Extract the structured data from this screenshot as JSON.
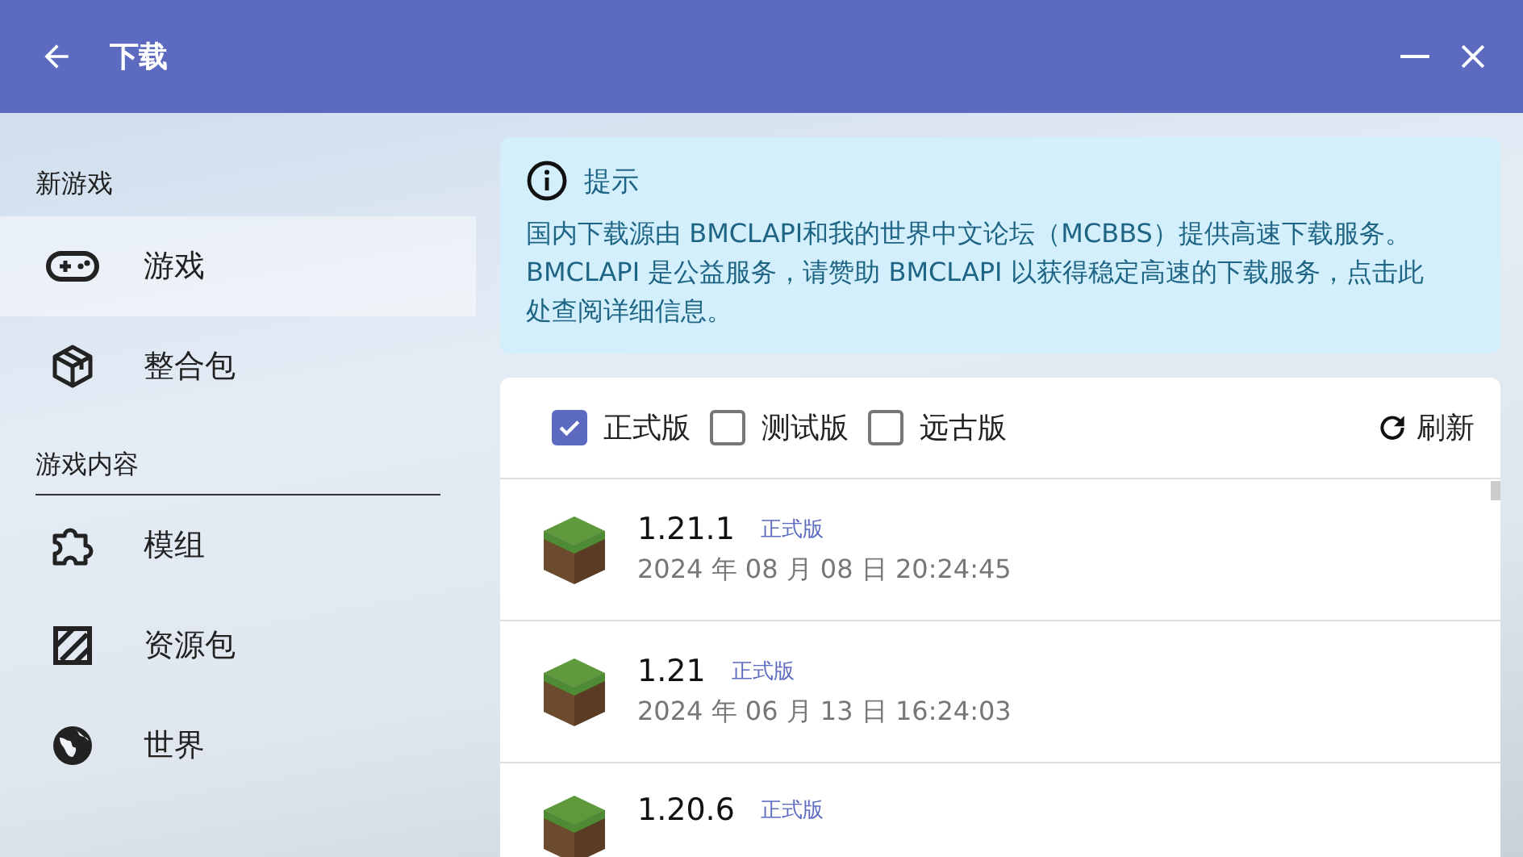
{
  "window": {
    "title": "下载"
  },
  "sidebar": {
    "sections": [
      {
        "title": "新游戏",
        "underlined": false,
        "items": [
          {
            "label": "游戏",
            "selected": true
          },
          {
            "label": "整合包",
            "selected": false
          }
        ]
      },
      {
        "title": "游戏内容",
        "underlined": true,
        "items": [
          {
            "label": "模组",
            "selected": false
          },
          {
            "label": "资源包",
            "selected": false
          },
          {
            "label": "世界",
            "selected": false
          }
        ]
      }
    ]
  },
  "notice": {
    "title": "提示",
    "text": "国内下载源由 BMCLAPI和我的世界中文论坛（MCBBS）提供高速下载服务。BMCLAPI 是公益服务，请赞助 BMCLAPI 以获得稳定高速的下载服务，点击此处查阅详细信息。"
  },
  "filters": [
    {
      "label": "正式版",
      "checked": true
    },
    {
      "label": "测试版",
      "checked": false
    },
    {
      "label": "远古版",
      "checked": false
    }
  ],
  "refresh": {
    "label": "刷新"
  },
  "versions": [
    {
      "version": "1.21.1",
      "tag": "正式版",
      "date": "2024 年 08 月 08 日 20:24:45"
    },
    {
      "version": "1.21",
      "tag": "正式版",
      "date": "2024 年 06 月 13 日 16:24:03"
    },
    {
      "version": "1.20.6",
      "tag": "正式版"
    }
  ]
}
